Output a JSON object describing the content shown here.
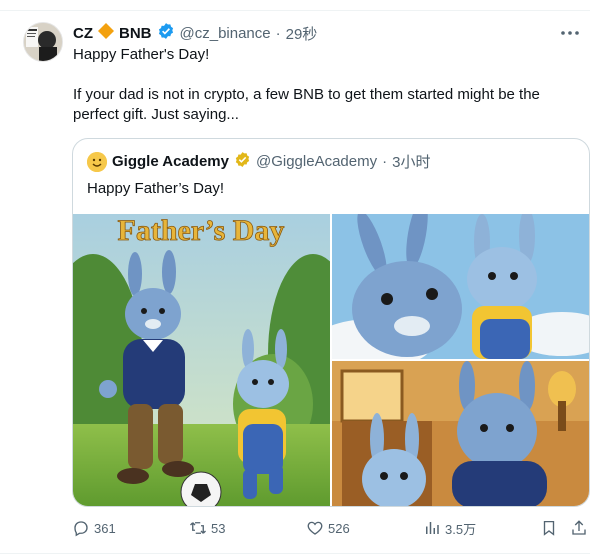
{
  "post": {
    "author_name": "CZ",
    "author_suffix": "BNB",
    "handle": "@cz_binance",
    "separator": "·",
    "time": "29秒",
    "text_line1": "Happy Father's Day!",
    "text_line2": "If your dad is not in crypto, a few BNB to get them started might be the perfect gift. Just saying..."
  },
  "quoted": {
    "name": "Giggle Academy",
    "handle": "@GiggleAcademy",
    "separator": "·",
    "time": "3小时",
    "text": "Happy Father’s Day!",
    "image_title": "Father’s Day"
  },
  "actions": {
    "replies": "361",
    "reposts": "53",
    "likes": "526",
    "views": "3.5万"
  },
  "colors": {
    "verified": "#1d9bf0",
    "gold_badge": "#e2b719",
    "bnb_diamond": "#f3a10f",
    "muted": "#536471"
  },
  "icons": [
    "verified-badge-icon",
    "gold-verified-badge-icon",
    "bnb-diamond-icon",
    "more-icon",
    "reply-icon",
    "repost-icon",
    "like-icon",
    "views-icon",
    "bookmark-icon",
    "share-icon"
  ]
}
